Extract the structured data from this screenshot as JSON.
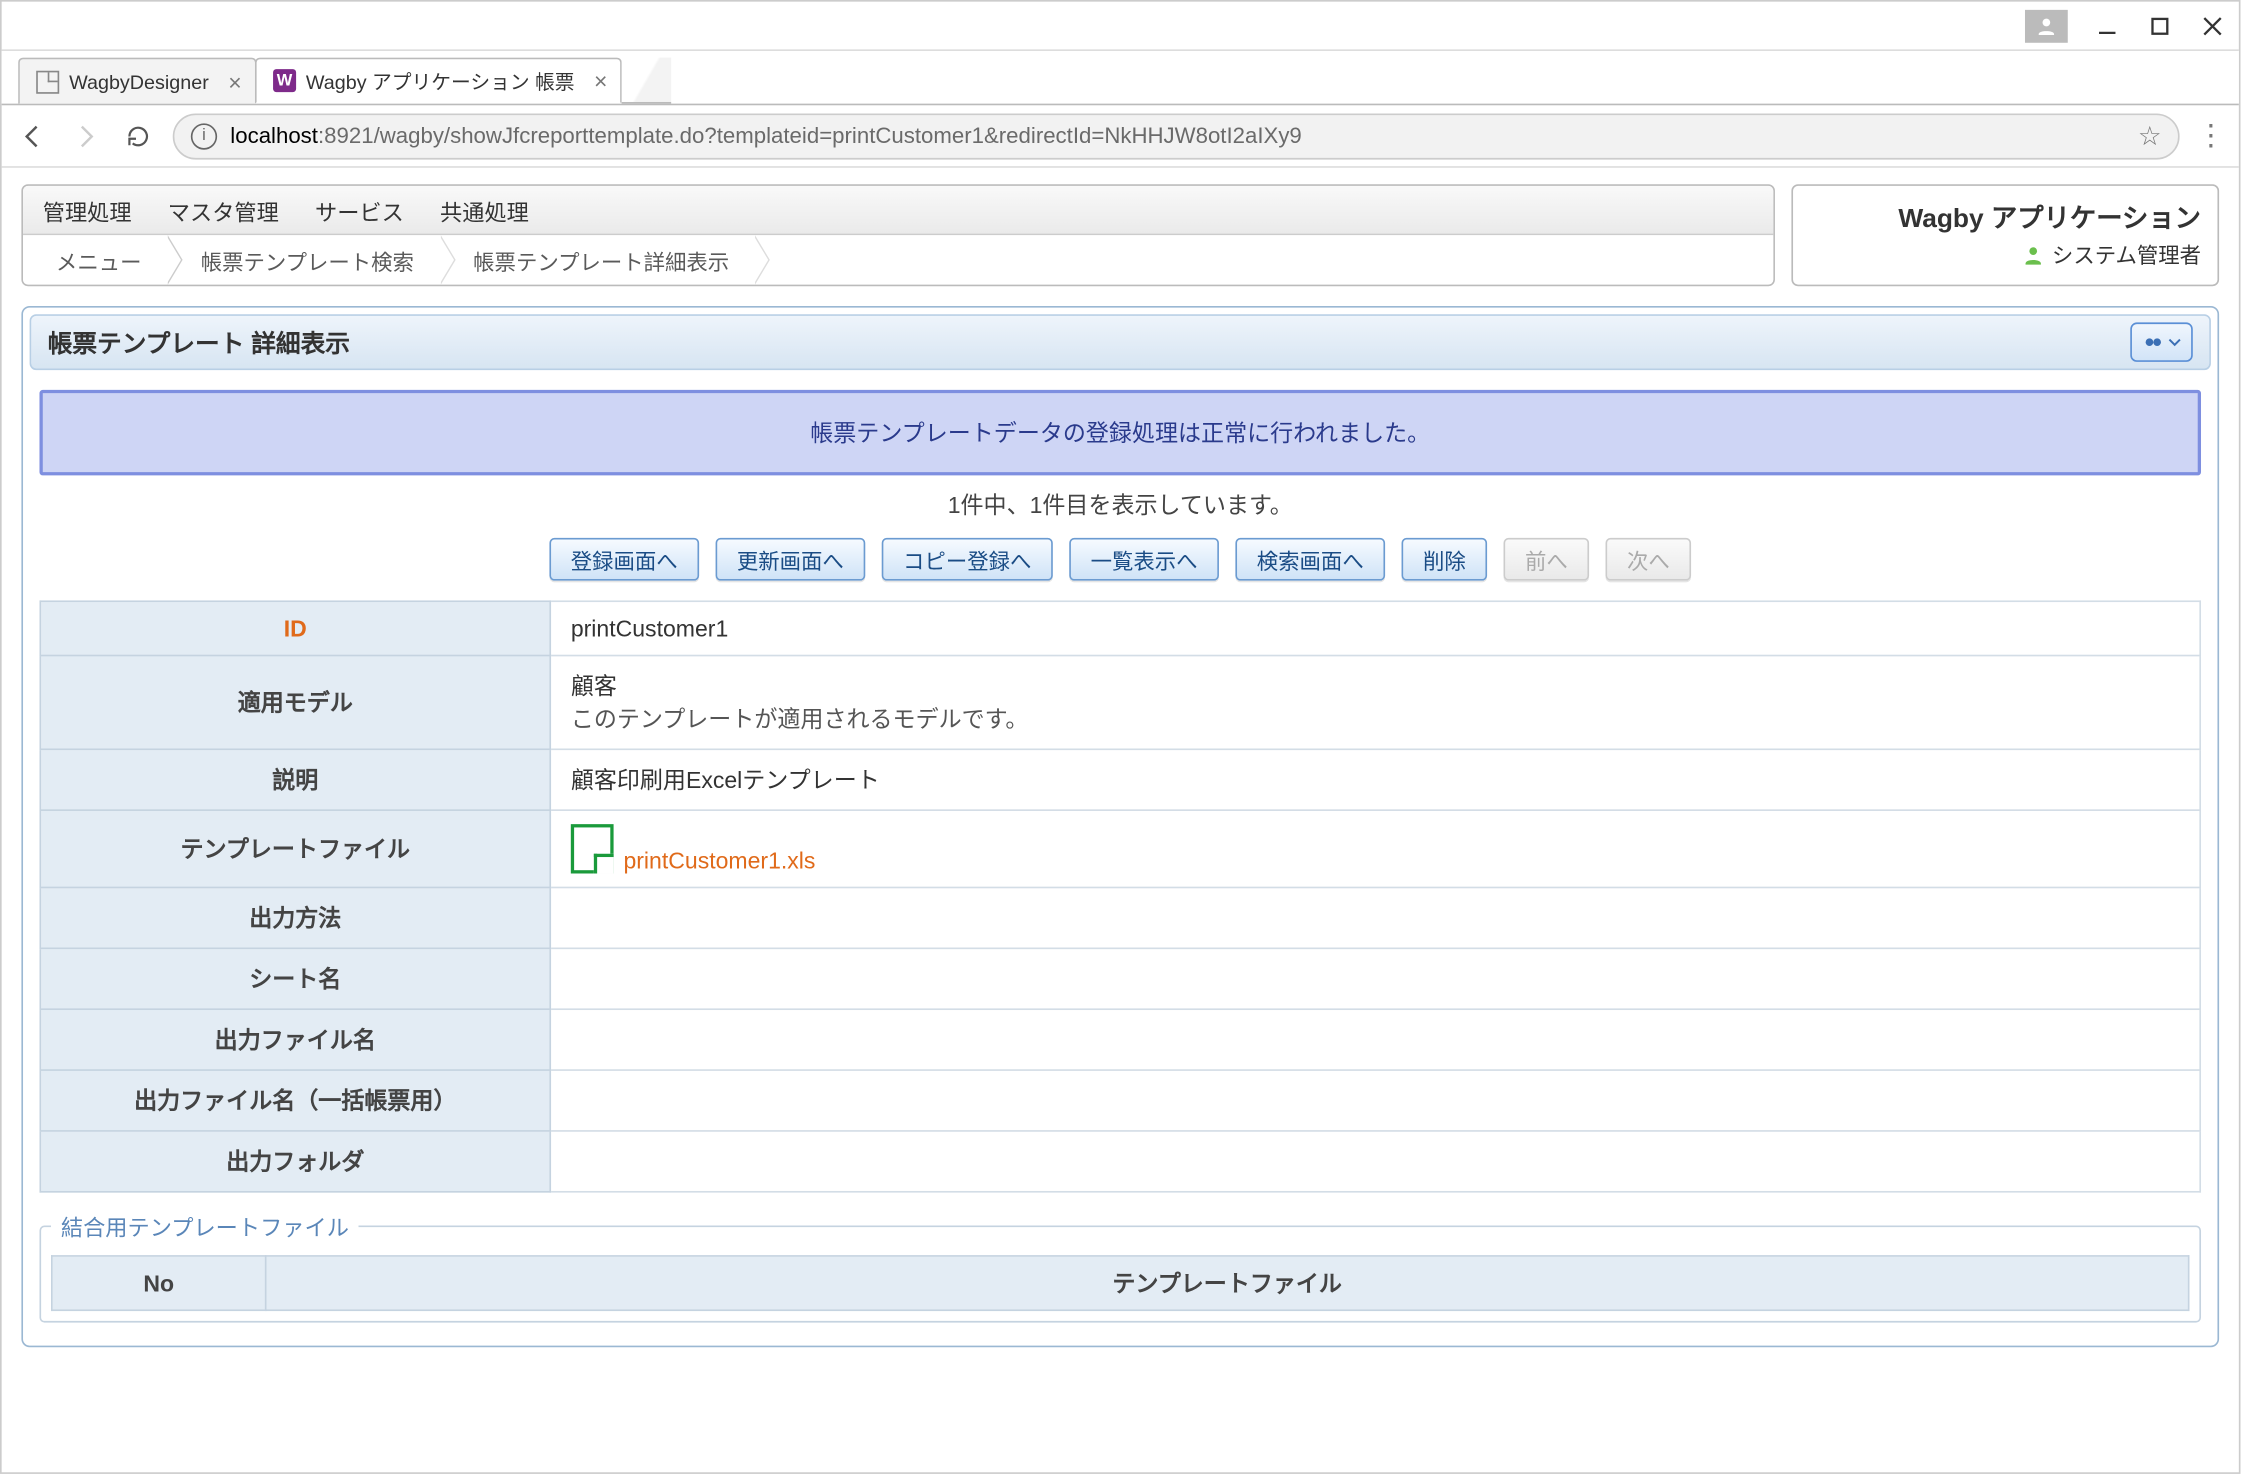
{
  "window": {
    "tabs": [
      {
        "title": "WagbyDesigner",
        "active": false
      },
      {
        "title": "Wagby アプリケーション 帳票",
        "active": true
      }
    ],
    "url_host": "localhost",
    "url_port": ":8921",
    "url_path": "/wagby/showJfcreporttemplate.do?templateid=printCustomer1&redirectId=NkHHJW8otI2aIXy9"
  },
  "header": {
    "global_menu": [
      "管理処理",
      "マスタ管理",
      "サービス",
      "共通処理"
    ],
    "breadcrumbs": [
      "メニュー",
      "帳票テンプレート検索",
      "帳票テンプレート詳細表示"
    ],
    "app_title": "Wagby アプリケーション",
    "user_name": "システム管理者"
  },
  "panel": {
    "title": "帳票テンプレート 詳細表示",
    "message": "帳票テンプレートデータの登録処理は正常に行われました。",
    "count_text": "1件中、1件目を表示しています。",
    "buttons": {
      "register": "登録画面へ",
      "update": "更新画面へ",
      "copy": "コピー登録へ",
      "list": "一覧表示へ",
      "search": "検索画面へ",
      "delete": "削除",
      "prev": "前へ",
      "next": "次へ"
    }
  },
  "detail": {
    "rows": {
      "id_label": "ID",
      "id_value": "printCustomer1",
      "model_label": "適用モデル",
      "model_value": "顧客",
      "model_note": "このテンプレートが適用されるモデルです。",
      "desc_label": "説明",
      "desc_value": "顧客印刷用Excelテンプレート",
      "file_label": "テンプレートファイル",
      "file_name": "printCustomer1.xls",
      "outmethod_label": "出力方法",
      "sheet_label": "シート名",
      "outfile_label": "出力ファイル名",
      "outfile_bulk_label": "出力ファイル名（一括帳票用）",
      "outfolder_label": "出力フォルダ"
    }
  },
  "merge": {
    "legend": "結合用テンプレートファイル",
    "col_no": "No",
    "col_file": "テンプレートファイル"
  }
}
